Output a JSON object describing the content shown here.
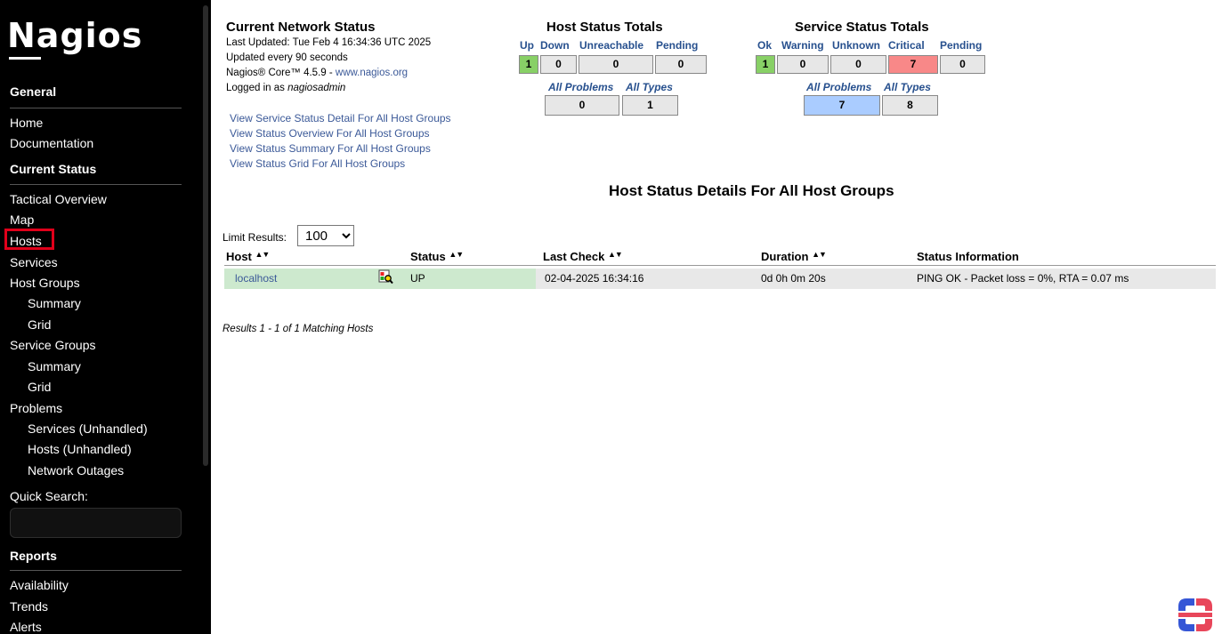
{
  "sidebar": {
    "logo": "Nagios",
    "general_heading": "General",
    "home": "Home",
    "documentation": "Documentation",
    "current_status_heading": "Current Status",
    "tactical_overview": "Tactical Overview",
    "map": "Map",
    "hosts": "Hosts",
    "services": "Services",
    "host_groups": "Host Groups",
    "host_groups_summary": "Summary",
    "host_groups_grid": "Grid",
    "service_groups": "Service Groups",
    "service_groups_summary": "Summary",
    "service_groups_grid": "Grid",
    "problems": "Problems",
    "services_unhandled": "Services (Unhandled)",
    "hosts_unhandled": "Hosts (Unhandled)",
    "network_outages": "Network Outages",
    "quick_search_label": "Quick Search:",
    "quick_search_value": "",
    "reports_heading": "Reports",
    "availability": "Availability",
    "trends": "Trends",
    "alerts": "Alerts",
    "highlight_color": "#e0001a"
  },
  "network_status": {
    "title": "Current Network Status",
    "last_updated": "Last Updated: Tue Feb 4 16:34:36 UTC 2025",
    "update_interval": "Updated every 90 seconds",
    "version_prefix": "Nagios® Core™ 4.5.9 - ",
    "version_link": "www.nagios.org",
    "logged_in_prefix": "Logged in as ",
    "logged_in_user": "nagiosadmin",
    "links": [
      "View Service Status Detail For All Host Groups",
      "View Status Overview For All Host Groups",
      "View Status Summary For All Host Groups",
      "View Status Grid For All Host Groups"
    ]
  },
  "host_totals": {
    "title": "Host Status Totals",
    "up_label": "Up",
    "down_label": "Down",
    "unreachable_label": "Unreachable",
    "pending_label": "Pending",
    "up": "1",
    "down": "0",
    "unreachable": "0",
    "pending": "0",
    "all_problems_label": "All Problems",
    "all_types_label": "All Types",
    "all_problems": "0",
    "all_types": "1"
  },
  "service_totals": {
    "title": "Service Status Totals",
    "ok_label": "Ok",
    "warning_label": "Warning",
    "unknown_label": "Unknown",
    "critical_label": "Critical",
    "pending_label": "Pending",
    "ok": "1",
    "warning": "0",
    "unknown": "0",
    "critical": "7",
    "pending": "0",
    "all_problems_label": "All Problems",
    "all_types_label": "All Types",
    "all_problems": "7",
    "all_types": "8"
  },
  "details": {
    "title": "Host Status Details For All Host Groups",
    "limit_label": "Limit Results:",
    "limit_value": "100",
    "limit_options": [
      "100"
    ],
    "columns": [
      "Host",
      "Status",
      "Last Check",
      "Duration",
      "Status Information"
    ],
    "rows": [
      {
        "host": "localhost",
        "status": "UP",
        "last_check": "02-04-2025 16:34:16",
        "duration": "0d 0h 0m 20s",
        "info": "PING OK - Packet loss = 0%, RTA = 0.07 ms"
      }
    ],
    "results_text": "Results 1 - 1 of 1 Matching Hosts"
  },
  "colors": {
    "ok_green": "#88d066",
    "critical_red": "#f88888",
    "problems_blue": "#aaccff",
    "row_up_green": "#cde9ce",
    "link_blue": "#3b5998"
  },
  "icons": {
    "sort": "sort-arrows-icon",
    "detail": "host-detail-icon",
    "brand": "brand-logo-icon"
  }
}
